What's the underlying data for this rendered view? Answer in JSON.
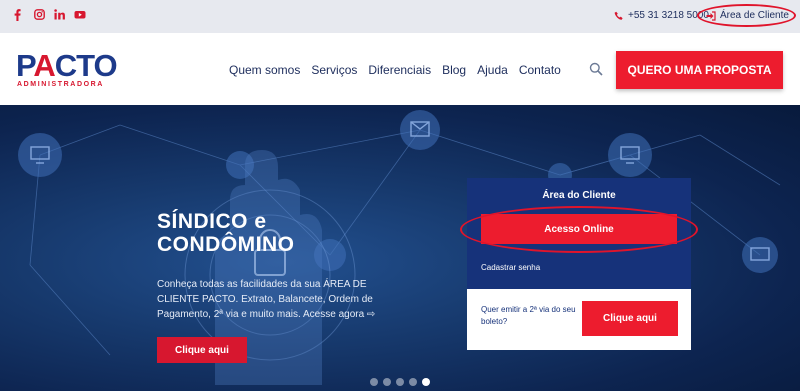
{
  "topbar": {
    "social_icons": [
      "facebook-icon",
      "instagram-icon",
      "linkedin-icon",
      "youtube-icon"
    ],
    "phone": "+55 31 3218 5000",
    "client_area_label": "Área de Cliente"
  },
  "header": {
    "logo_text": "PACTO",
    "logo_subtitle": "ADMINISTRADORA",
    "nav": [
      "Quem somos",
      "Serviços",
      "Diferenciais",
      "Blog",
      "Ajuda",
      "Contato"
    ],
    "cta_label": "QUERO UMA PROPOSTA"
  },
  "hero": {
    "title_line1": "SÍNDICO e",
    "title_line2": "CONDÔMINO",
    "description": "Conheça todas as facilidades da sua ÁREA DE CLIENTE PACTO. Extrato, Balancete, Ordem de Pagamento, 2ª via e muito mais. Acesse agora ⇨",
    "button_label": "Clique aqui",
    "slides_total": 5,
    "active_slide": 5
  },
  "client_panel": {
    "title": "Área do Cliente",
    "access_button": "Acesso Online",
    "register_link": "Cadastrar senha",
    "boleto_question": "Quer emitir a 2ª via do seu boleto?",
    "boleto_button": "Clique aqui"
  },
  "colors": {
    "brand_blue": "#1d3a8a",
    "brand_red": "#ed1c2e",
    "topbar_bg": "#e7e9ef",
    "panel_blue": "#16327a",
    "highlight_ring": "#e0142b"
  }
}
